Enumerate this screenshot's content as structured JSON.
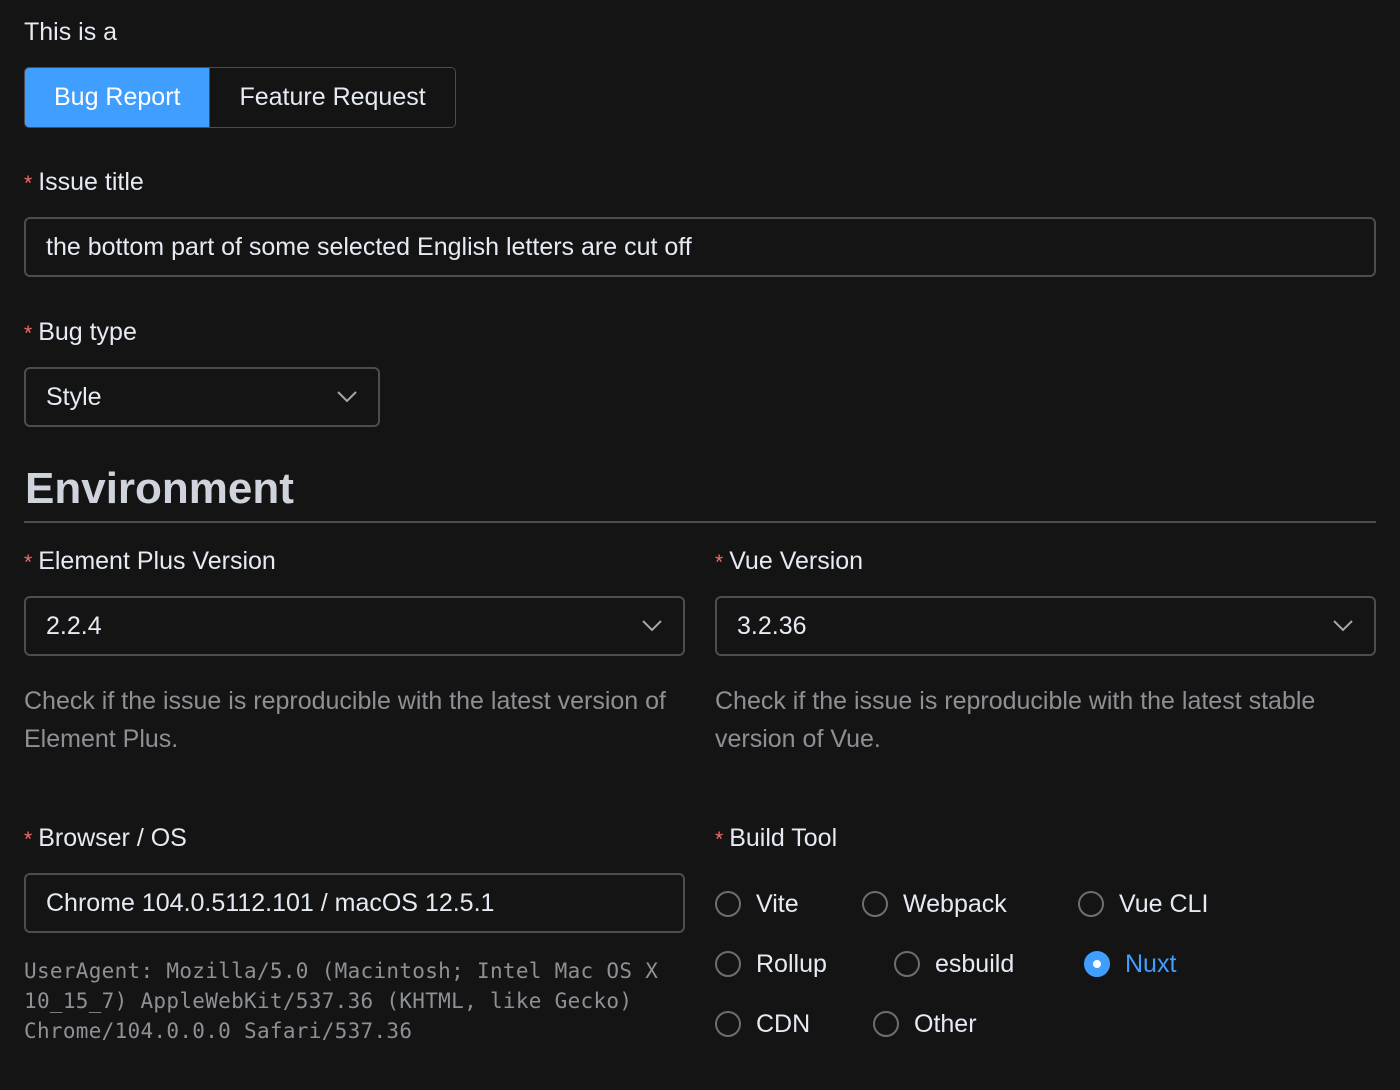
{
  "form": {
    "issue_type_label": "This is a",
    "issue_types": [
      {
        "label": "Bug Report",
        "selected": true
      },
      {
        "label": "Feature Request",
        "selected": false
      }
    ],
    "required_mark": "*",
    "issue_title": {
      "label": "Issue title",
      "value": "the bottom part of some selected English letters are cut off"
    },
    "bug_type": {
      "label": "Bug type",
      "value": "Style"
    }
  },
  "environment": {
    "heading": "Environment",
    "element_plus": {
      "label": "Element Plus Version",
      "value": "2.2.4",
      "help": "Check if the issue is reproducible with the latest version of Element Plus."
    },
    "vue": {
      "label": "Vue Version",
      "value": "3.2.36",
      "help": "Check if the issue is reproducible with the latest stable version of Vue."
    },
    "browser_os": {
      "label": "Browser / OS",
      "value": "Chrome 104.0.5112.101 / macOS 12.5.1",
      "user_agent": "UserAgent: Mozilla/5.0 (Macintosh; Intel Mac OS X 10_15_7) AppleWebKit/537.36 (KHTML, like Gecko) Chrome/104.0.0.0 Safari/537.36"
    },
    "build_tool": {
      "label": "Build Tool",
      "selected": "Nuxt",
      "options": [
        "Vite",
        "Webpack",
        "Vue CLI",
        "Rollup",
        "esbuild",
        "Nuxt",
        "CDN",
        "Other"
      ]
    }
  },
  "colors": {
    "accent": "#409eff",
    "required": "#f56c6c",
    "background": "#141414",
    "border": "#4c4d4f",
    "muted_text": "#8d9095"
  },
  "icons": {
    "select_arrow": "chevron-down-icon"
  }
}
